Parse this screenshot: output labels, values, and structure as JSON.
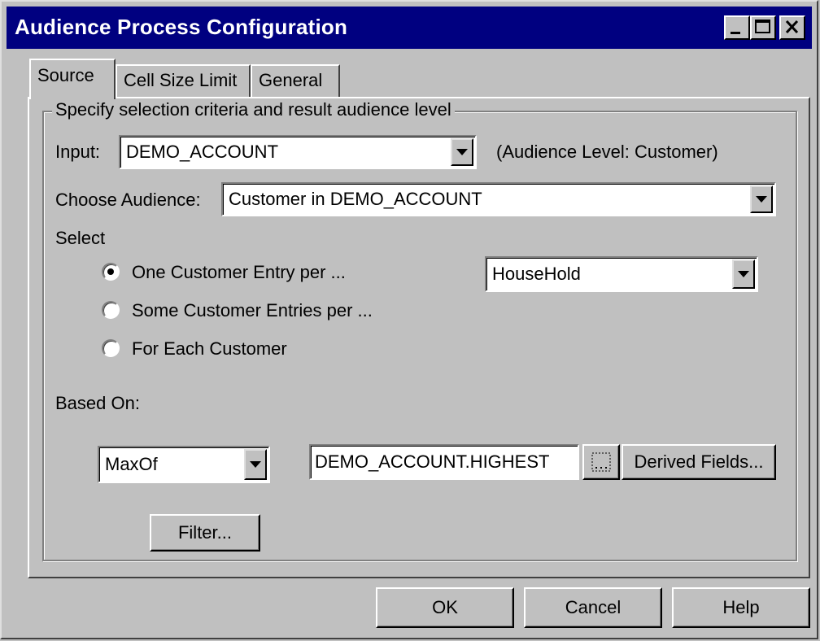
{
  "window": {
    "title": "Audience Process Configuration",
    "controls": [
      "minimize-icon",
      "maximize-icon",
      "close-icon"
    ]
  },
  "tabs": [
    {
      "label": "Source",
      "active": true
    },
    {
      "label": "Cell Size Limit",
      "active": false
    },
    {
      "label": "General",
      "active": false
    }
  ],
  "group": {
    "legend": "Specify selection criteria and result audience level"
  },
  "input": {
    "label": "Input:",
    "value": "DEMO_ACCOUNT",
    "audience_level": "(Audience Level: Customer)"
  },
  "choose_audience": {
    "label": "Choose Audience:",
    "value": "Customer in DEMO_ACCOUNT"
  },
  "select": {
    "label": "Select",
    "options": [
      {
        "label": "One Customer Entry per ...",
        "checked": true
      },
      {
        "label": "Some Customer Entries per ...",
        "checked": false
      },
      {
        "label": "For Each Customer",
        "checked": false
      }
    ],
    "per_value": "HouseHold"
  },
  "based_on": {
    "label": "Based On:",
    "function_value": "MaxOf",
    "field_value": "DEMO_ACCOUNT.HIGHEST",
    "derived_fields_label": "Derived Fields..."
  },
  "filter_label": "Filter...",
  "buttons": {
    "ok": "OK",
    "cancel": "Cancel",
    "help": "Help"
  }
}
